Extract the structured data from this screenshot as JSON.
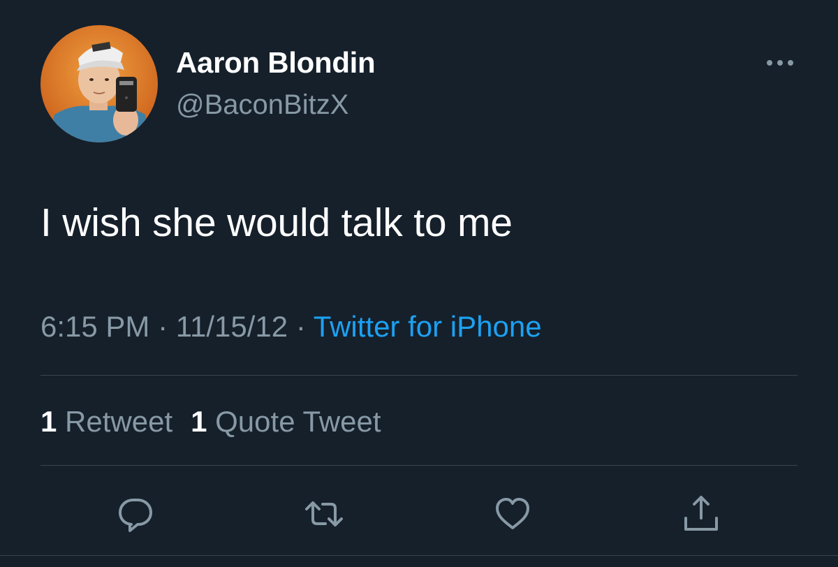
{
  "author": {
    "display_name": "Aaron Blondin",
    "handle": "@BaconBitzX",
    "avatar_icon": "profile-photo"
  },
  "tweet": {
    "text": "I wish she would talk to me"
  },
  "meta": {
    "time": "6:15 PM",
    "separator": "·",
    "date": "11/15/12",
    "source": "Twitter for iPhone"
  },
  "stats": {
    "retweets_count": "1",
    "retweets_label": "Retweet",
    "quotes_count": "1",
    "quotes_label": "Quote Tweet"
  },
  "actions": [
    "reply-icon",
    "retweet-icon",
    "like-icon",
    "share-icon"
  ],
  "colors": {
    "background": "#15202b",
    "primary_text": "#ffffff",
    "secondary_text": "#8899a6",
    "accent": "#1da1f2",
    "divider": "#38444d"
  }
}
